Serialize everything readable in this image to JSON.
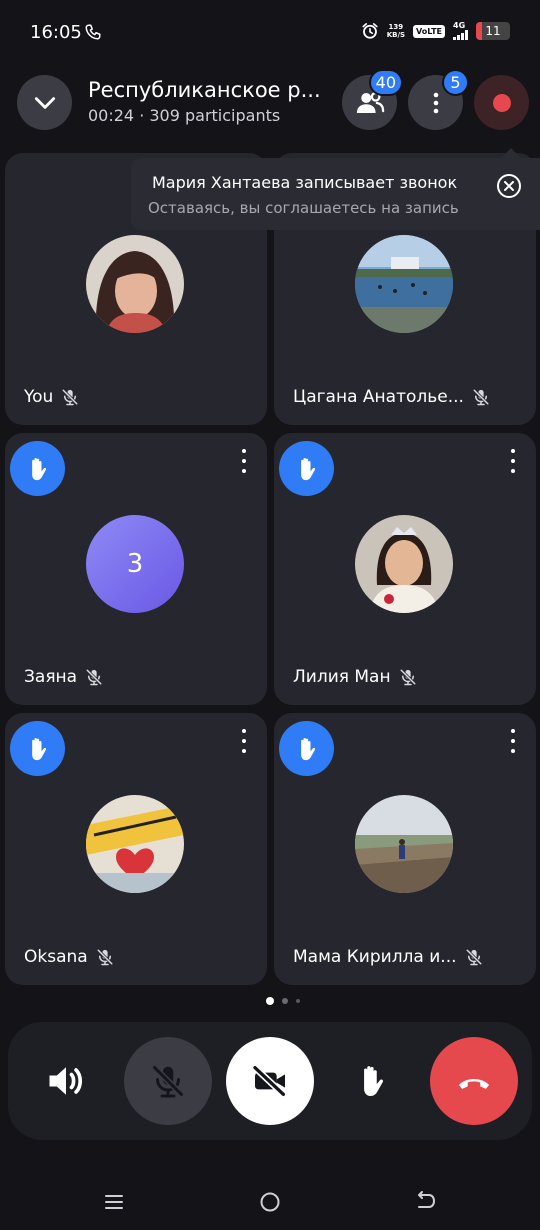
{
  "status_bar": {
    "time": "16:05",
    "net_speed": "139",
    "net_unit": "KB/S",
    "volte": "VoLTE",
    "network": "4G",
    "battery": "11"
  },
  "header": {
    "title": "Республиканское р...",
    "subtitle": "00:24 · 309 participants",
    "participants_badge": "40",
    "more_badge": "5"
  },
  "tooltip": {
    "title": "Мария Хантаева записывает звонок",
    "subtitle": "Оставаясь, вы соглашаетесь на запись"
  },
  "tiles": [
    {
      "name": "You",
      "hand_raised": false
    },
    {
      "name": "Цагана Анатолье...",
      "hand_raised": false
    },
    {
      "name": "Заяна",
      "hand_raised": true,
      "initial": "3"
    },
    {
      "name": "Лилия Ман",
      "hand_raised": true
    },
    {
      "name": "Oksana",
      "hand_raised": true
    },
    {
      "name": "Мама Кирилла и...",
      "hand_raised": true
    }
  ],
  "pagination": {
    "pages": 3,
    "current": 1
  },
  "colors": {
    "accent": "#2f7cf6",
    "danger": "#e5484d",
    "tile_bg": "#26272e",
    "bg": "#141418"
  },
  "icons": {
    "collapse": "chevron-down-icon",
    "participants": "people-icon",
    "more": "more-vertical-icon",
    "record": "record-icon",
    "speaker": "speaker-icon",
    "mic": "mic-off-icon",
    "camera": "camera-off-icon",
    "hand": "raise-hand-icon",
    "end_call": "end-call-icon"
  }
}
